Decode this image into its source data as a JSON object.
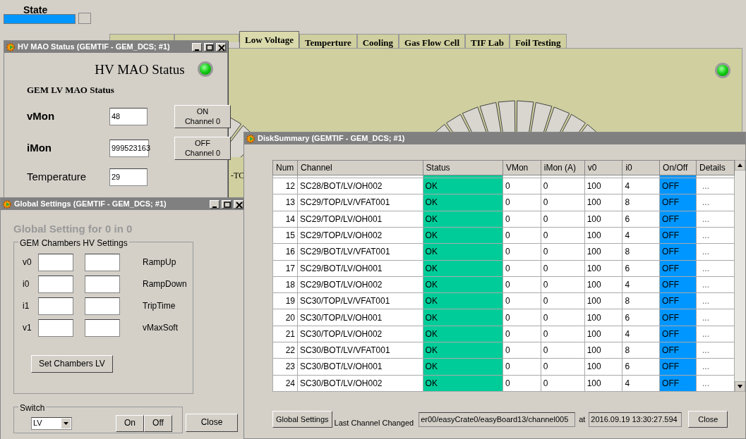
{
  "state": {
    "label": "State"
  },
  "tabs": [
    {
      "selected": false
    },
    {
      "selected": false
    },
    {
      "label": "Low Voltage",
      "selected": true
    },
    {
      "label": "Temperture",
      "selected": false
    },
    {
      "label": "Cooling",
      "selected": false
    },
    {
      "label": "Gas Flow Cell",
      "selected": false
    },
    {
      "label": "TIF Lab",
      "selected": false
    },
    {
      "label": "Foil Testing",
      "selected": false
    }
  ],
  "panel": {
    "led_on": true,
    "fragment": "-TC"
  },
  "hv_window": {
    "title": "HV MAO Status (GEMTIF - GEM_DCS; #1)",
    "heading": "HV MAO Status",
    "led_on": true,
    "subheading": "GEM LV MAO Status",
    "rows": [
      {
        "label": "vMon",
        "value": "48",
        "button": [
          "ON",
          "Channel 0"
        ]
      },
      {
        "label": "iMon",
        "value": "999523163",
        "button": [
          "OFF",
          "Channel 0"
        ]
      },
      {
        "label": "Temperature",
        "value": "29"
      }
    ]
  },
  "global_window": {
    "title": "Global Settings (GEMTIF - GEM_DCS; #1)",
    "heading": "Global Setting for 0 in 0",
    "group": "GEM Chambers HV Settings",
    "rows": [
      {
        "label": "v0",
        "name": "RampUp"
      },
      {
        "label": "i0",
        "name": "RampDown"
      },
      {
        "label": "i1",
        "name": "TripTime"
      },
      {
        "label": "v1",
        "name": "vMaxSoft"
      }
    ],
    "set_button": "Set Chambers LV",
    "switch_group": "Switch",
    "switch_value": "LV",
    "buttons": [
      "On",
      "Off"
    ],
    "close": "Close"
  },
  "disk_window": {
    "title": "DiskSummary (GEMTIF - GEM_DCS; #1)",
    "table": {
      "columns": [
        "Num",
        "Channel",
        "Status",
        "VMon",
        "iMon (A)",
        "v0",
        "i0",
        "On/Off",
        "Details"
      ],
      "rows": [
        [
          "12",
          "SC28/BOT/LV/OH002",
          "OK",
          "0",
          "0",
          "100",
          "4",
          "OFF",
          "..."
        ],
        [
          "13",
          "SC29/TOP/LV/VFAT001",
          "OK",
          "0",
          "0",
          "100",
          "8",
          "OFF",
          "..."
        ],
        [
          "14",
          "SC29/TOP/LV/OH001",
          "OK",
          "0",
          "0",
          "100",
          "6",
          "OFF",
          "..."
        ],
        [
          "15",
          "SC29/TOP/LV/OH002",
          "OK",
          "0",
          "0",
          "100",
          "4",
          "OFF",
          "..."
        ],
        [
          "16",
          "SC29/BOT/LV/VFAT001",
          "OK",
          "0",
          "0",
          "100",
          "8",
          "OFF",
          "..."
        ],
        [
          "17",
          "SC29/BOT/LV/OH001",
          "OK",
          "0",
          "0",
          "100",
          "6",
          "OFF",
          "..."
        ],
        [
          "18",
          "SC29/BOT/LV/OH002",
          "OK",
          "0",
          "0",
          "100",
          "4",
          "OFF",
          "..."
        ],
        [
          "19",
          "SC30/TOP/LV/VFAT001",
          "OK",
          "0",
          "0",
          "100",
          "8",
          "OFF",
          "..."
        ],
        [
          "20",
          "SC30/TOP/LV/OH001",
          "OK",
          "0",
          "0",
          "100",
          "6",
          "OFF",
          "..."
        ],
        [
          "21",
          "SC30/TOP/LV/OH002",
          "OK",
          "0",
          "0",
          "100",
          "4",
          "OFF",
          "..."
        ],
        [
          "22",
          "SC30/BOT/LV/VFAT001",
          "OK",
          "0",
          "0",
          "100",
          "8",
          "OFF",
          "..."
        ],
        [
          "23",
          "SC30/BOT/LV/OH001",
          "OK",
          "0",
          "0",
          "100",
          "6",
          "OFF",
          "..."
        ],
        [
          "24",
          "SC30/BOT/LV/OH002",
          "OK",
          "0",
          "0",
          "100",
          "4",
          "OFF",
          "..."
        ]
      ]
    },
    "global_button": "Global Settings",
    "last_label": "Last Channel Changed",
    "last_value": "er00/easyCrate0/easyBoard13/channel005",
    "at_label": "at",
    "time_value": "2016.09.19 13:30:27.594",
    "close": "Close"
  }
}
